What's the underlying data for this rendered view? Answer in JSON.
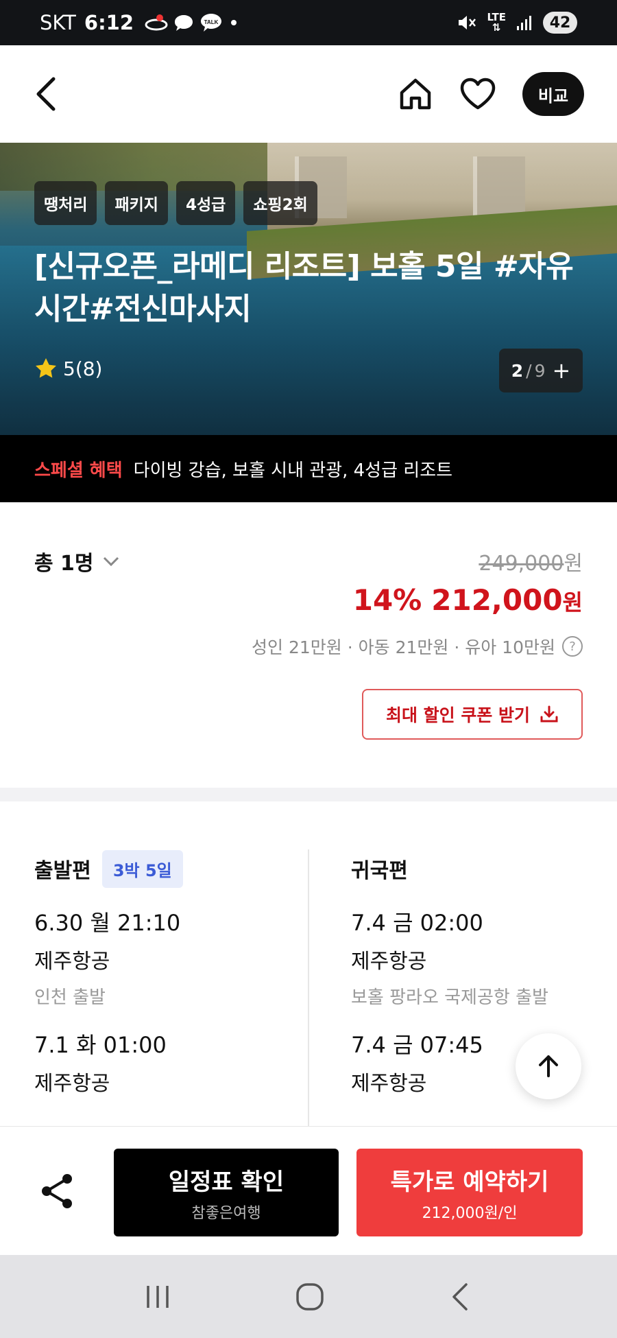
{
  "status_bar": {
    "carrier": "SKT",
    "time": "6:12",
    "network": "LTE",
    "battery": "42"
  },
  "nav": {
    "compare_label": "비교"
  },
  "hero": {
    "tags": [
      "땡처리",
      "패키지",
      "4성급",
      "쇼핑2회"
    ],
    "title": "[신규오픈_라메디 리조트] 보홀 5일 #자유시간#전신마사지",
    "rating": "5(8)",
    "photo_current": "2",
    "photo_separator": "/",
    "photo_total": "9"
  },
  "benefit": {
    "label": "스페셜 혜택",
    "text": "다이빙 강습, 보홀 시내 관광, 4성급 리조트"
  },
  "price": {
    "pax_label": "총 1명",
    "original": "249,000",
    "original_unit": "원",
    "discount": "14%",
    "sale": "212,000",
    "sale_unit": "원",
    "breakdown": "성인 21만원 · 아동 21만원 · 유아 10만원",
    "coupon_label": "최대 할인 쿠폰 받기"
  },
  "flights": {
    "departure": {
      "title": "출발편",
      "badge": "3박 5일",
      "legs": [
        {
          "time": "6.30 월 21:10",
          "airline": "제주항공",
          "location": "인천 출발"
        },
        {
          "time": "7.1 화 01:00",
          "airline": "제주항공"
        }
      ]
    },
    "return": {
      "title": "귀국편",
      "legs": [
        {
          "time": "7.4 금 02:00",
          "airline": "제주항공",
          "location": "보홀 팡라오 국제공항 출발"
        },
        {
          "time": "7.4 금 07:45",
          "airline": "제주항공"
        }
      ]
    }
  },
  "actions": {
    "schedule_label": "일정표 확인",
    "schedule_sub": "참좋은여행",
    "book_label": "특가로 예약하기",
    "book_sub": "212,000원/인"
  },
  "colors": {
    "accent_red": "#ef3d3d",
    "price_red": "#d0141c",
    "benefit_red": "#ff4a4a",
    "badge_blue": "#3b5bd6"
  }
}
